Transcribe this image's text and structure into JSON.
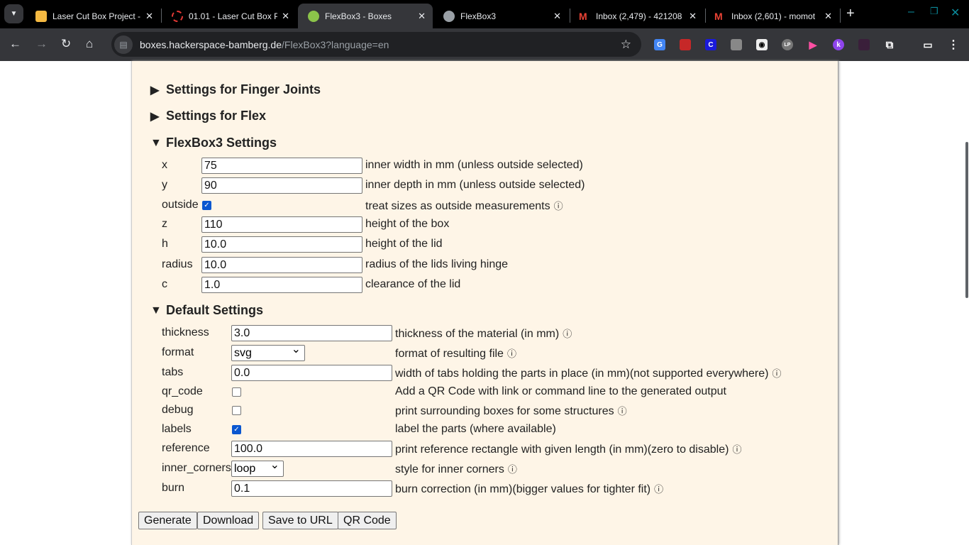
{
  "browser": {
    "tabs": [
      {
        "title": "Laser Cut Box Project -",
        "active": false
      },
      {
        "title": "01.01 - Laser Cut Box P",
        "active": false
      },
      {
        "title": "FlexBox3 - Boxes",
        "active": true
      },
      {
        "title": "FlexBox3",
        "active": false
      },
      {
        "title": "Inbox (2,479) - 421208",
        "active": false
      },
      {
        "title": "Inbox (2,601) - momot",
        "active": false
      }
    ],
    "url_host": "boxes.hackerspace-bamberg.de",
    "url_path": "/FlexBox3?language=en"
  },
  "sections": {
    "finger": "Settings for Finger Joints",
    "flex": "Settings for Flex",
    "flexbox3": "FlexBox3 Settings",
    "defaults": "Default Settings"
  },
  "flexbox3": [
    {
      "label": "x",
      "value": "75",
      "desc": "inner width in mm (unless outside selected)"
    },
    {
      "label": "y",
      "value": "90",
      "desc": "inner depth in mm (unless outside selected)"
    },
    {
      "label": "outside",
      "checked": true,
      "desc": "treat sizes as outside measurements",
      "info": true
    },
    {
      "label": "z",
      "value": "110",
      "desc": "height of the box"
    },
    {
      "label": "h",
      "value": "10.0",
      "desc": "height of the lid"
    },
    {
      "label": "radius",
      "value": "10.0",
      "desc": "radius of the lids living hinge"
    },
    {
      "label": "c",
      "value": "1.0",
      "desc": "clearance of the lid"
    }
  ],
  "defaults": [
    {
      "label": "thickness",
      "value": "3.0",
      "desc": "thickness of the material (in mm)",
      "info": true
    },
    {
      "label": "format",
      "select": "svg",
      "desc": "format of resulting file",
      "info": true
    },
    {
      "label": "tabs",
      "value": "0.0",
      "desc": "width of tabs holding the parts in place (in mm)(not supported everywhere)",
      "info": true
    },
    {
      "label": "qr_code",
      "checked": false,
      "desc": "Add a QR Code with link or command line to the generated output"
    },
    {
      "label": "debug",
      "checked": false,
      "desc": "print surrounding boxes for some structures",
      "info": true
    },
    {
      "label": "labels",
      "checked": true,
      "desc": "label the parts (where available)"
    },
    {
      "label": "reference",
      "value": "100.0",
      "desc": "print reference rectangle with given length (in mm)(zero to disable)",
      "info": true
    },
    {
      "label": "inner_corners",
      "select": "loop",
      "desc": "style for inner corners",
      "info": true
    },
    {
      "label": "burn",
      "value": "0.1",
      "desc": "burn correction (in mm)(bigger values for tighter fit)",
      "info": true
    }
  ],
  "buttons": {
    "generate": "Generate",
    "download": "Download",
    "save_url": "Save to URL",
    "qr": "QR Code"
  },
  "info_glyph": "ⓘ"
}
